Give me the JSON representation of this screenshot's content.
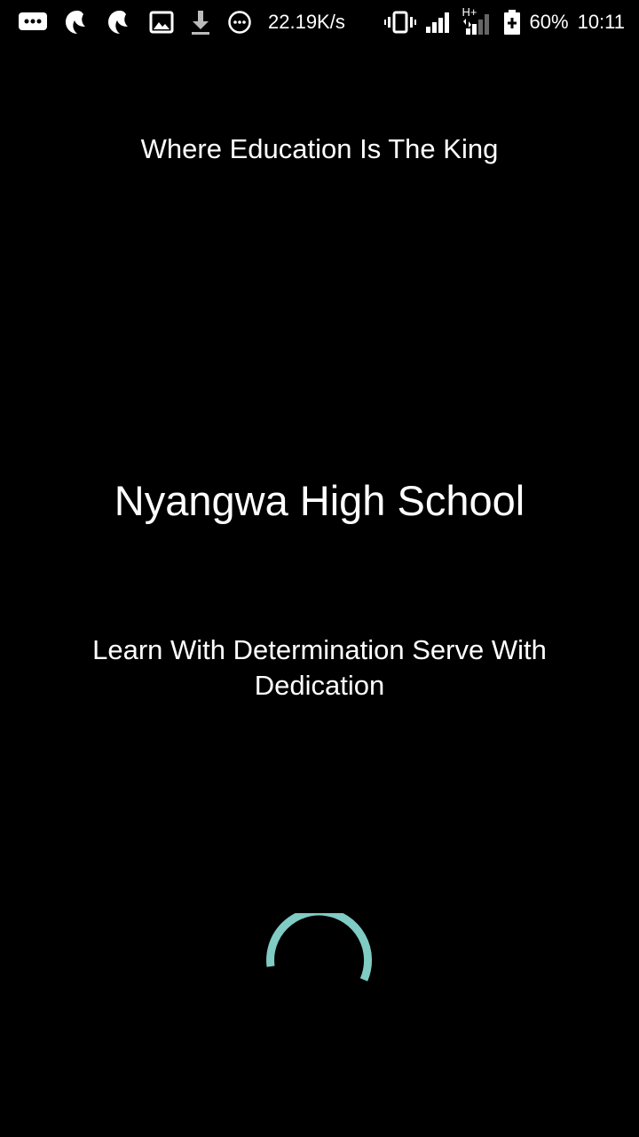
{
  "status_bar": {
    "net_speed": "22.19K/s",
    "network_type": "H+",
    "battery_percent": "60%",
    "time": "10:11",
    "left_icons": [
      "chat-bubble-icon",
      "bird-app-icon",
      "bird-app-icon-2",
      "image-icon",
      "download-icon",
      "smiley-circle-icon"
    ],
    "right_icons": [
      "vibrate-icon",
      "signal-icon",
      "signal-hplus-icon",
      "battery-icon"
    ]
  },
  "splash": {
    "tagline": "Where Education Is The King",
    "title": "Nyangwa High School",
    "motto": "Learn With Determination Serve With Dedication"
  },
  "colors": {
    "background": "#000000",
    "text": "#ffffff",
    "spinner": "#80cbc4"
  }
}
